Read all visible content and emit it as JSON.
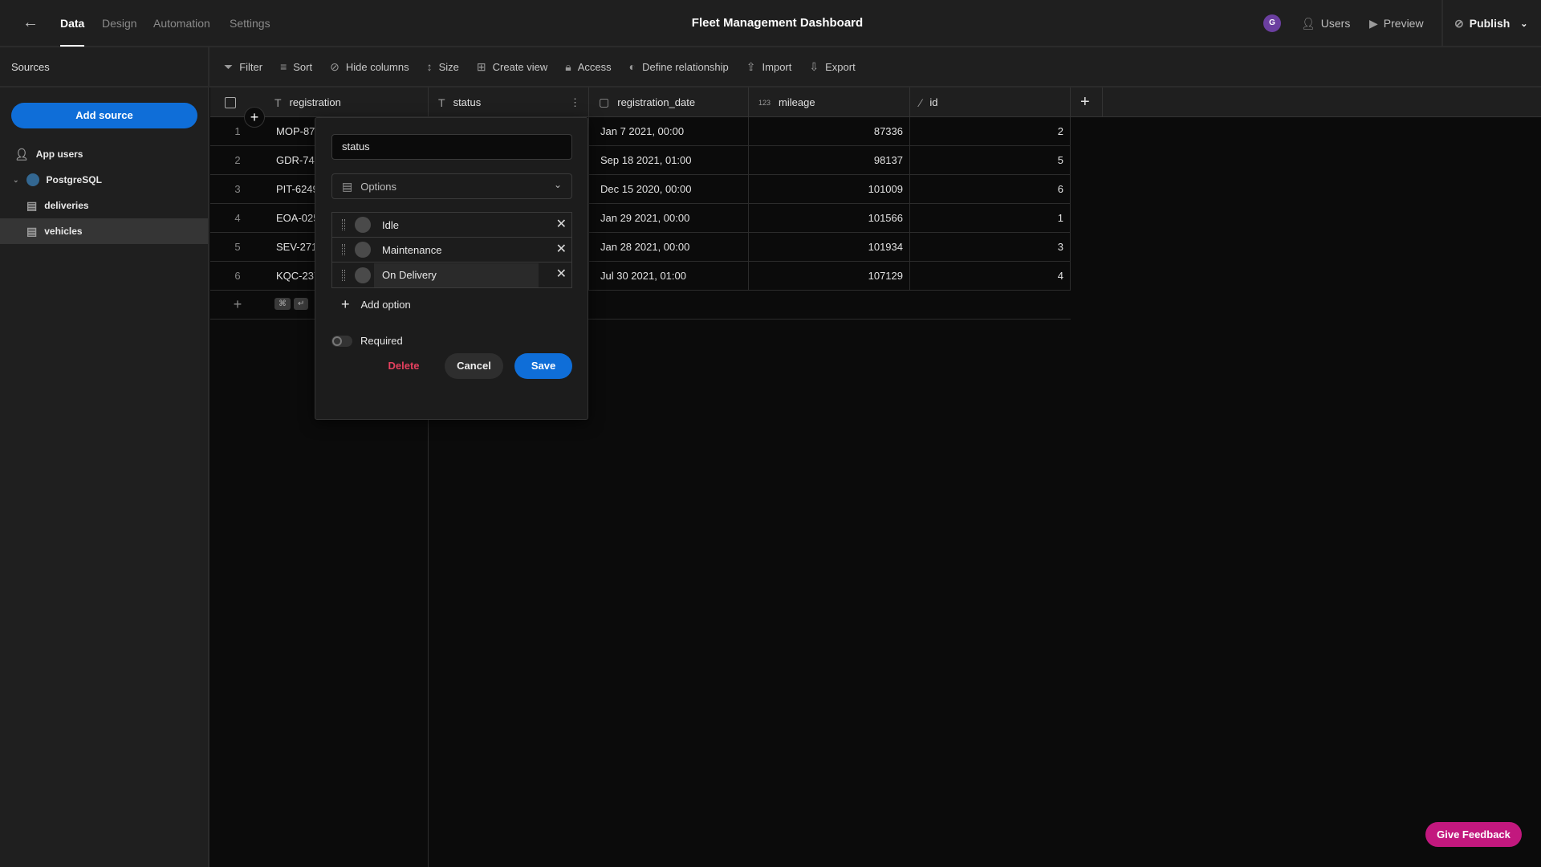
{
  "topbar": {
    "tabs": [
      "Data",
      "Design",
      "Automation",
      "Settings"
    ],
    "active_tab": "Data",
    "title": "Fleet Management Dashboard",
    "avatar_initial": "G",
    "avatar_color": "#6b3fa0",
    "users": "Users",
    "preview": "Preview",
    "publish": "Publish"
  },
  "sidebar": {
    "heading": "Sources",
    "add_source": "Add source",
    "items": [
      {
        "label": "App users",
        "icon": "user-icon"
      },
      {
        "label": "PostgreSQL",
        "icon": "postgresql-icon"
      },
      {
        "label": "deliveries",
        "icon": "table-icon"
      },
      {
        "label": "vehicles",
        "icon": "table-icon",
        "selected": true
      }
    ]
  },
  "toolbar": {
    "items": [
      {
        "label": "Filter",
        "icon": "filter-icon"
      },
      {
        "label": "Sort",
        "icon": "sort-icon"
      },
      {
        "label": "Hide columns",
        "icon": "eye-off-icon"
      },
      {
        "label": "Size",
        "icon": "size-icon"
      },
      {
        "label": "Create view",
        "icon": "create-view-icon"
      },
      {
        "label": "Access",
        "icon": "lock-icon"
      },
      {
        "label": "Define relationship",
        "icon": "relationship-icon"
      },
      {
        "label": "Import",
        "icon": "import-icon"
      },
      {
        "label": "Export",
        "icon": "export-icon"
      }
    ]
  },
  "table": {
    "columns": [
      {
        "name": "registration",
        "type_icon": "T"
      },
      {
        "name": "status",
        "type_icon": "T"
      },
      {
        "name": "registration_date",
        "type_icon": "calendar"
      },
      {
        "name": "mileage",
        "type_icon": "123"
      },
      {
        "name": "id",
        "type_icon": "magic-wand"
      }
    ],
    "rows": [
      {
        "n": "1",
        "registration": "MOP-873",
        "registration_date": "Jan 7 2021, 00:00",
        "mileage": "87336",
        "id": "2"
      },
      {
        "n": "2",
        "registration": "GDR-747",
        "registration_date": "Sep 18 2021, 01:00",
        "mileage": "98137",
        "id": "5"
      },
      {
        "n": "3",
        "registration": "PIT-6249",
        "registration_date": "Dec 15 2020, 00:00",
        "mileage": "101009",
        "id": "6"
      },
      {
        "n": "4",
        "registration": "EOA-025",
        "registration_date": "Jan 29 2021, 00:00",
        "mileage": "101566",
        "id": "1"
      },
      {
        "n": "5",
        "registration": "SEV-2710",
        "registration_date": "Jan 28 2021, 00:00",
        "mileage": "101934",
        "id": "3"
      },
      {
        "n": "6",
        "registration": "KQC-237",
        "registration_date": "Jul 30 2021, 01:00",
        "mileage": "107129",
        "id": "4"
      }
    ],
    "shortcut_keys": [
      "⌘",
      "↵"
    ]
  },
  "popup": {
    "column_name": "status",
    "type": "Options",
    "options": [
      "Idle",
      "Maintenance",
      "On Delivery"
    ],
    "add_option": "Add option",
    "required_label": "Required",
    "required": false,
    "delete": "Delete",
    "cancel": "Cancel",
    "save": "Save"
  },
  "feedback": "Give Feedback",
  "colors": {
    "accent": "#0f6ed8",
    "danger": "#e5405e",
    "feedback": "#c2187e"
  }
}
